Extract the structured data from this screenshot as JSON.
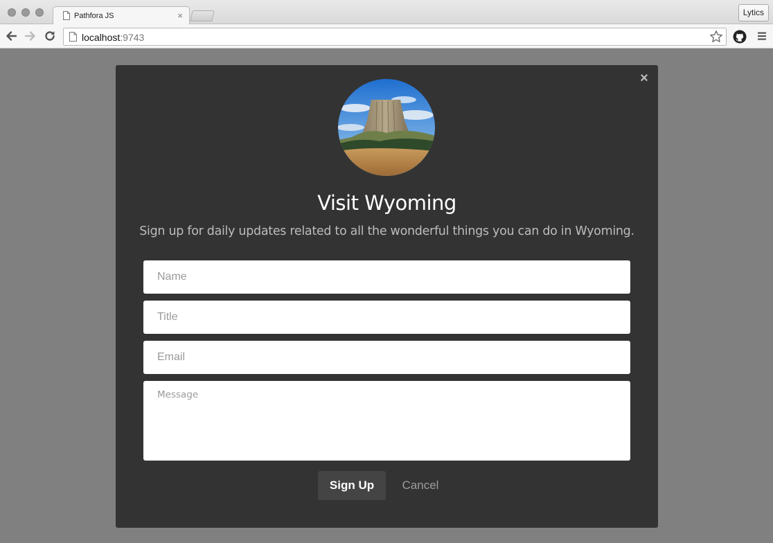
{
  "browser": {
    "tab_title": "Pathfora JS",
    "tab_close": "×",
    "profile_button": "Lytics",
    "url_host": "localhost",
    "url_port": ":9743"
  },
  "modal": {
    "close_glyph": "×",
    "image_alt": "Devils Tower, Wyoming",
    "title": "Visit Wyoming",
    "subtitle": "Sign up for daily updates related to all the wonderful things you can do in Wyoming.",
    "fields": {
      "name_placeholder": "Name",
      "title_placeholder": "Title",
      "email_placeholder": "Email",
      "message_placeholder": "Message"
    },
    "confirm_label": "Sign Up",
    "cancel_label": "Cancel"
  },
  "colors": {
    "overlay": "#808080",
    "modal_bg": "#333333",
    "confirm_bg": "#444444",
    "subtitle_text": "#bcbcbc",
    "cancel_text": "#9c9c9c"
  }
}
